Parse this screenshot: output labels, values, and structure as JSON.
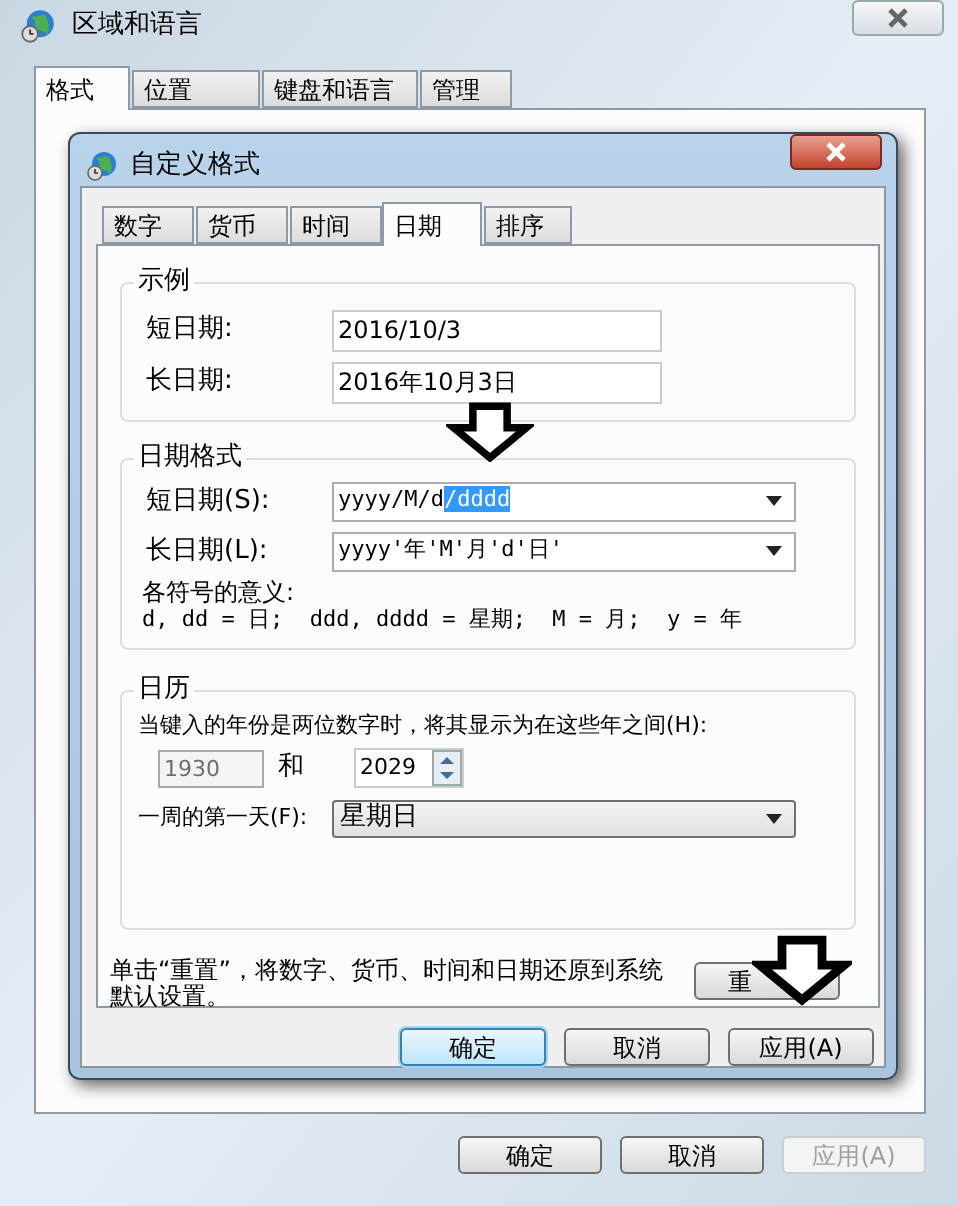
{
  "window": {
    "title": "区域和语言"
  },
  "tabs": [
    {
      "label": "格式",
      "selected": true
    },
    {
      "label": "位置",
      "selected": false
    },
    {
      "label": "键盘和语言",
      "selected": false
    },
    {
      "label": "管理",
      "selected": false
    }
  ],
  "buttons": [
    {
      "label": "确定",
      "disabled": false
    },
    {
      "label": "取消",
      "disabled": false
    },
    {
      "label": "应用(A)",
      "disabled": true
    }
  ],
  "dialog": {
    "title": "自定义格式",
    "tabs": [
      {
        "label": "数字",
        "selected": false
      },
      {
        "label": "货币",
        "selected": false
      },
      {
        "label": "时间",
        "selected": false
      },
      {
        "label": "日期",
        "selected": true
      },
      {
        "label": "排序",
        "selected": false
      }
    ],
    "example": {
      "title": "示例",
      "fields": [
        {
          "label": "短日期:",
          "value": "2016/10/3"
        },
        {
          "label": "长日期:",
          "value": "2016年10月3日"
        }
      ]
    },
    "date_format": {
      "title": "日期格式",
      "fields": [
        {
          "label": "短日期(S):",
          "value": "yyyy/M/d",
          "selection": "/dddd"
        },
        {
          "label": "长日期(L):",
          "value": "yyyy'年'M'月'd'日'"
        }
      ],
      "legend_title": "各符号的意义:",
      "legend": "d, dd = 日;  ddd, dddd = 星期;  M = 月;  y = 年"
    },
    "calendar": {
      "title": "日历",
      "prompt": "当键入的年份是两位数字时，将其显示为在这些年之间(H):",
      "from": {
        "value": "1930",
        "disabled": true
      },
      "and": "和",
      "to": {
        "value": "2029",
        "disabled": false
      },
      "first_day": {
        "label": "一周的第一天(F):",
        "value": "星期日"
      }
    },
    "reset": {
      "text": "单击“重置”，将数字、货币、时间和日期还原到系统默认设置。",
      "button": "重"
    },
    "buttons": [
      {
        "label": "确定",
        "default": true
      },
      {
        "label": "取消",
        "default": false
      },
      {
        "label": "应用(A)",
        "default": false
      }
    ]
  }
}
